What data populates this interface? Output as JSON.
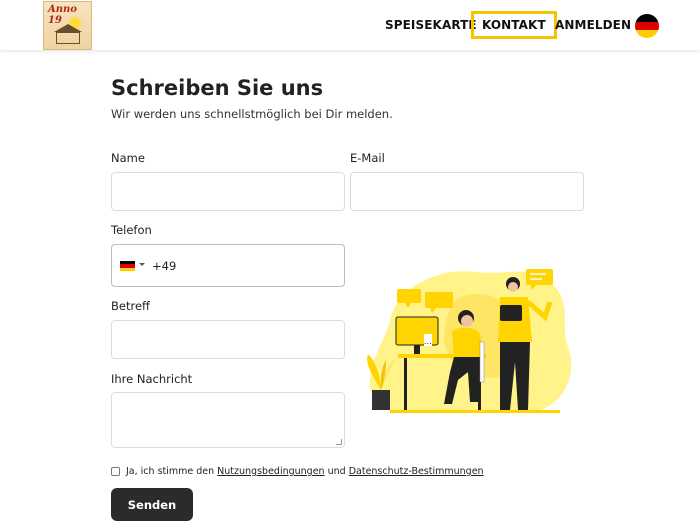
{
  "header": {
    "logo_text": "Anno 19",
    "nav": [
      "SPEISEKARTE",
      "KONTAKT",
      "ANMELDEN"
    ],
    "active_nav": "KONTAKT",
    "language_flag": "germany-flag-icon"
  },
  "form": {
    "title": "Schreiben Sie uns",
    "subtitle": "Wir werden uns schnellstmöglich bei Dir melden.",
    "name_label": "Name",
    "email_label": "E-Mail",
    "phone_label": "Telefon",
    "phone_prefix": "+49",
    "subject_label": "Betreff",
    "message_label": "Ihre Nachricht",
    "consent_prefix": "Ja, ich stimme den ",
    "terms_link": "Nutzungsbedingungen",
    "consent_middle": " und ",
    "privacy_link": "Datenschutz-Bestimmungen",
    "submit_label": "Senden"
  },
  "colors": {
    "accent": "#f5c400",
    "button": "#2b2b2b",
    "border": "#dcdcdc"
  },
  "illustration": "support-team-illustration"
}
